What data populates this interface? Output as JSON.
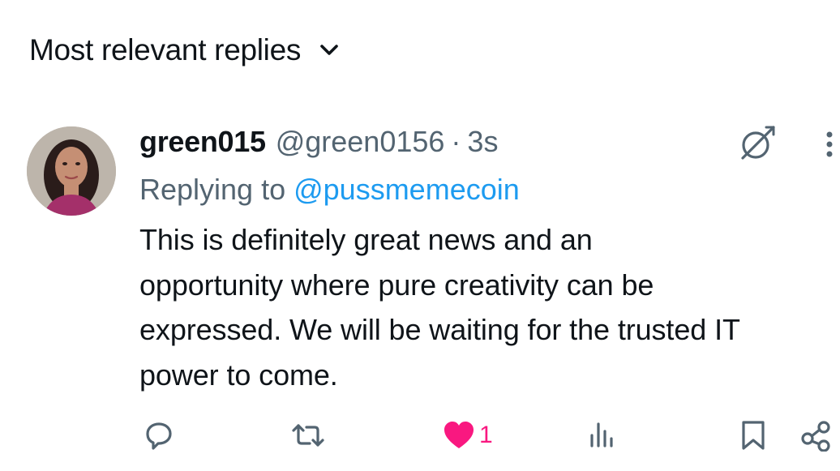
{
  "sort": {
    "label": "Most relevant replies",
    "chevron_icon": "chevron-down-icon"
  },
  "reply": {
    "display_name": "green015",
    "handle": "@green0156",
    "separator": "·",
    "time": "3s",
    "replying_prefix": "Replying to ",
    "replying_to": "@pussmemecoin",
    "text": "This is definitely great news and an\nopportunity where pure creativity can be\nexpressed. We will be waiting for the trusted IT\npower to come.",
    "avatar_icon": "user-avatar",
    "grok_icon": "grok-icon",
    "more_icon": "more-vertical-icon"
  },
  "actions": {
    "reply_icon": "reply-icon",
    "repost_icon": "repost-icon",
    "like_icon": "heart-filled-icon",
    "like_count": "1",
    "views_icon": "views-icon",
    "bookmark_icon": "bookmark-icon",
    "share_icon": "share-icon"
  },
  "colors": {
    "text_primary": "#0f1419",
    "text_secondary": "#536471",
    "link": "#1d9bf0",
    "like": "#f91880"
  }
}
